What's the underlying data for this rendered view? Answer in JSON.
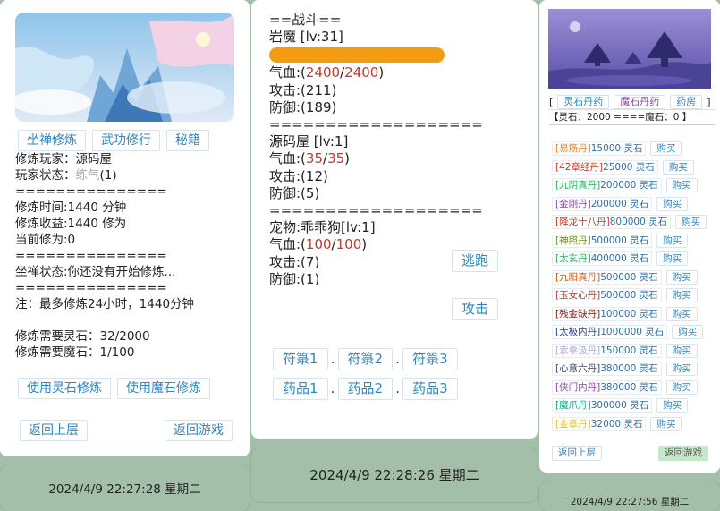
{
  "left": {
    "tabs": [
      "坐禅修炼",
      "武功修行",
      "秘籍"
    ],
    "player_label": "修炼玩家：",
    "player_name": "源码屋",
    "status_label": "玩家状态：",
    "status_value": "练气",
    "status_level": "(1)",
    "divider": "===============",
    "time": "修炼时间:1440 分钟",
    "gain": "修炼收益:1440 修为",
    "current": "当前修为:0",
    "state": "坐禅状态:你还没有开始修炼...",
    "note": "注：最多修炼24小时，1440分钟",
    "need_stone": "修炼需要灵石：32/2000",
    "need_magic": "修炼需要魔石：1/100",
    "use_stone": "使用灵石修炼",
    "use_magic": "使用魔石修炼",
    "back": "返回上层",
    "game": "返回游戏"
  },
  "middle": {
    "title": "==战斗==",
    "enemy": {
      "name": "岩魔 [lv:31]",
      "hp_label": "气血:(",
      "hp": "2400",
      "hp_max": "2400",
      "hp_bar_fraction": 1.0,
      "attack": "攻击:(211)",
      "defense": "防御:(189)"
    },
    "divider": "===================",
    "player": {
      "name": "源码屋 [lv:1]",
      "hp_label": "气血:(",
      "hp": "35",
      "hp_max": "35",
      "attack": "攻击:(12)",
      "defense": "防御:(5)"
    },
    "pet": {
      "name": "宠物:乖乖狗[lv:1]",
      "hp_label": "气血:(",
      "hp": "100",
      "hp_max": "100",
      "attack": "攻击:(7)",
      "defense": "防御:(1)"
    },
    "flee": "逃跑",
    "attack_btn": "攻击",
    "talismans": [
      "符箓1",
      "符箓2",
      "符箓3"
    ],
    "potions": [
      "药品1",
      "药品2",
      "药品3"
    ],
    "dot": "."
  },
  "right": {
    "tabs": [
      "灵石丹药",
      "魔石丹药",
      "药房"
    ],
    "bracket_l": "[",
    "bracket_r": "]",
    "balance": "【灵石：2000 ====魔石：0 】",
    "buy": "购买",
    "items": [
      {
        "name": "[易筋丹]",
        "price": "15000 灵石",
        "color": "#e67e22"
      },
      {
        "name": "[42章经丹]",
        "price": "25000 灵石",
        "color": "#c0392b"
      },
      {
        "name": "[九阴真丹]",
        "price": "200000 灵石",
        "color": "#27ae60"
      },
      {
        "name": "[金刚丹]",
        "price": "200000 灵石",
        "color": "#8e44ad"
      },
      {
        "name": "[降龙十八丹]",
        "price": "800000 灵石",
        "color": "#c0392b"
      },
      {
        "name": "[神照丹]",
        "price": "500000 灵石",
        "color": "#6b8e23"
      },
      {
        "name": "[太玄丹]",
        "price": "400000 灵石",
        "color": "#27ae60"
      },
      {
        "name": "[九阳真丹]",
        "price": "500000 灵石",
        "color": "#d35400"
      },
      {
        "name": "[玉女心丹]",
        "price": "500000 灵石",
        "color": "#c0392b"
      },
      {
        "name": "[残金缺丹]",
        "price": "100000 灵石",
        "color": "#7b241c"
      },
      {
        "name": "[太极内丹]",
        "price": "1000000 灵石",
        "color": "#2c3e80"
      },
      {
        "name": "[索拳汲丹]",
        "price": "150000 灵石",
        "color": "#b0a8d8"
      },
      {
        "name": "[心意六丹]",
        "price": "380000 灵石",
        "color": "#34495e"
      },
      {
        "name": "[侠门内丹]",
        "price": "380000 灵石",
        "color": "#8e44ad"
      },
      {
        "name": "[魔爪丹]",
        "price": "300000 灵石",
        "color": "#16a085"
      },
      {
        "name": "[金章丹]",
        "price": "32000 灵石",
        "color": "#e6c229"
      }
    ],
    "back": "返回上层",
    "game": "返回游戏"
  },
  "footers": {
    "left": "2024/4/9 22:27:28 星期二",
    "middle": "2024/4/9 22:28:26 星期二",
    "right": "2024/4/9 22:27:56 星期二"
  }
}
